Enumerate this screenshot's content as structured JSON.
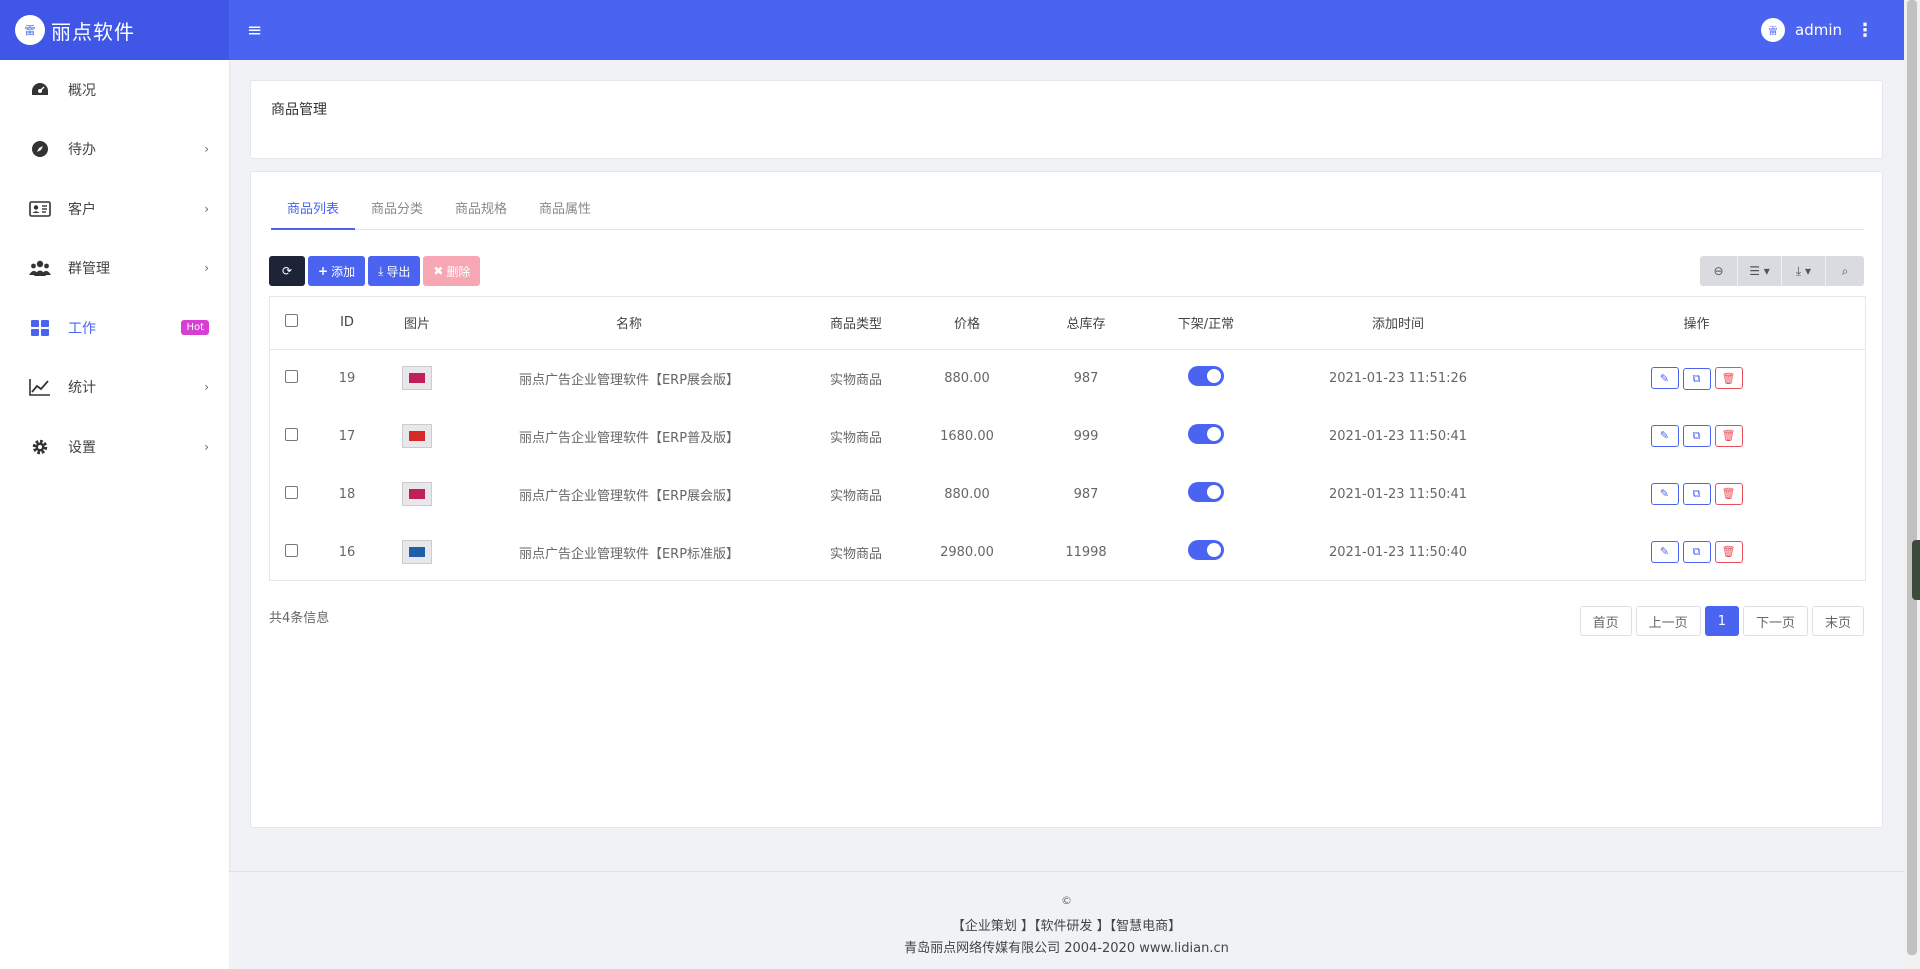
{
  "header": {
    "brand_logo": "雷",
    "brand_name": "丽点软件",
    "user_avatar": "雷",
    "user_name": "admin"
  },
  "sidebar": {
    "items": [
      {
        "label": "概况",
        "icon": "dashboard-icon",
        "arrow": false
      },
      {
        "label": "待办",
        "icon": "compass-icon",
        "arrow": true
      },
      {
        "label": "客户",
        "icon": "id-card-icon",
        "arrow": true
      },
      {
        "label": "群管理",
        "icon": "group-icon",
        "arrow": true
      },
      {
        "label": "工作",
        "icon": "grid-icon",
        "badge": "Hot",
        "active": true
      },
      {
        "label": "统计",
        "icon": "line-chart-icon",
        "arrow": true
      },
      {
        "label": "设置",
        "icon": "gear-icon",
        "arrow": true
      }
    ]
  },
  "page": {
    "title": "商品管理"
  },
  "tabs": [
    "商品列表",
    "商品分类",
    "商品规格",
    "商品属性"
  ],
  "toolbar": {
    "add_label": "添加",
    "export_label": "导出",
    "delete_label": "删除"
  },
  "table": {
    "columns": [
      "ID",
      "图片",
      "名称",
      "商品类型",
      "价格",
      "总库存",
      "下架/正常",
      "添加时间",
      "操作"
    ],
    "rows": [
      {
        "id": "19",
        "name": "丽点广告企业管理软件【ERP展会版】",
        "type": "实物商品",
        "price": "880.00",
        "stock": "987",
        "enabled": true,
        "time": "2021-01-23 11:51:26",
        "thumb_color": "#c0205a"
      },
      {
        "id": "17",
        "name": "丽点广告企业管理软件【ERP普及版】",
        "type": "实物商品",
        "price": "1680.00",
        "stock": "999",
        "enabled": true,
        "time": "2021-01-23 11:50:41",
        "thumb_color": "#d42a2a"
      },
      {
        "id": "18",
        "name": "丽点广告企业管理软件【ERP展会版】",
        "type": "实物商品",
        "price": "880.00",
        "stock": "987",
        "enabled": true,
        "time": "2021-01-23 11:50:41",
        "thumb_color": "#c0205a"
      },
      {
        "id": "16",
        "name": "丽点广告企业管理软件【ERP标准版】",
        "type": "实物商品",
        "price": "2980.00",
        "stock": "11998",
        "enabled": true,
        "time": "2021-01-23 11:50:40",
        "thumb_color": "#1f5fa8"
      }
    ]
  },
  "pagination": {
    "total": "共4条信息",
    "first": "首页",
    "prev": "上一页",
    "current": "1",
    "next": "下一页",
    "last": "末页"
  },
  "footer": {
    "copyright_symbol": "©",
    "links": "【企业策划 】【软件研发 】【智慧电商】",
    "company": "青岛丽点网络传媒有限公司 2004-2020 www.lidian.cn"
  },
  "colors": {
    "primary": "#4a63f0",
    "danger": "#e8505b",
    "hot": "#d53fd2"
  }
}
